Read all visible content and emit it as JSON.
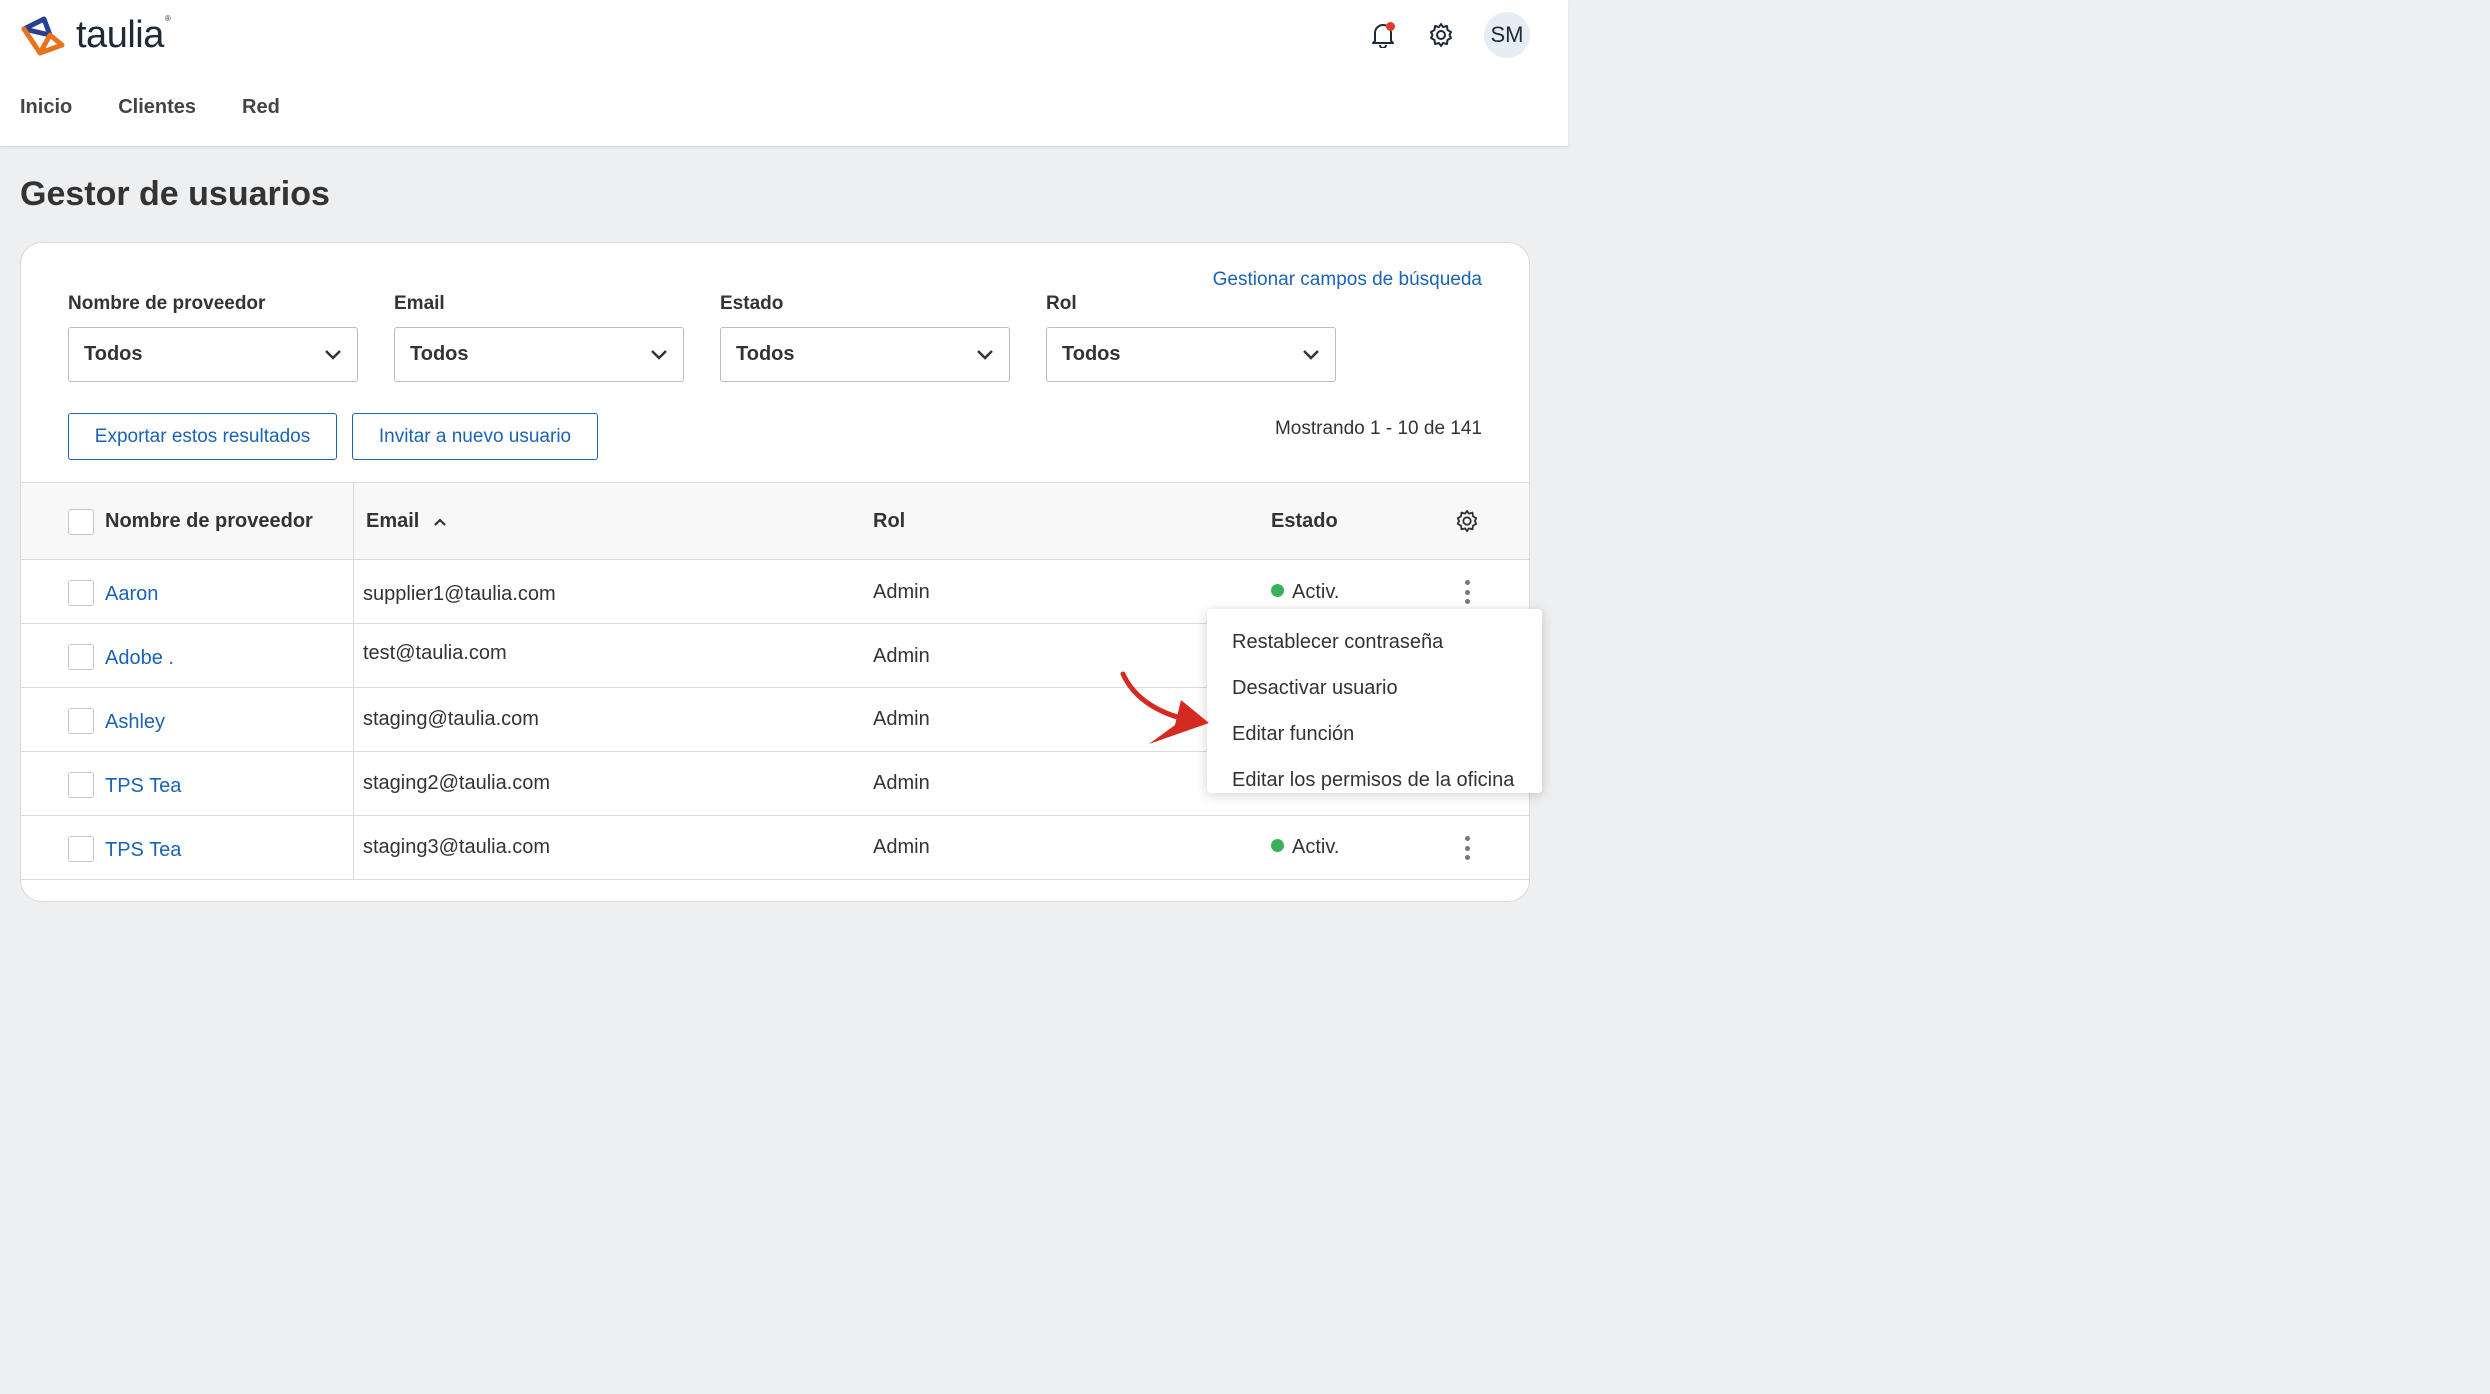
{
  "header": {
    "logo_text": "taulia",
    "user_initials": "SM"
  },
  "nav": {
    "items": [
      "Inicio",
      "Clientes",
      "Red"
    ]
  },
  "page": {
    "title": "Gestor de usuarios"
  },
  "filters": {
    "manage_link": "Gestionar campos de búsqueda",
    "items": [
      {
        "label": "Nombre de proveedor",
        "value": "Todos"
      },
      {
        "label": "Email",
        "value": "Todos"
      },
      {
        "label": "Estado",
        "value": "Todos"
      },
      {
        "label": "Rol",
        "value": "Todos"
      }
    ]
  },
  "actions": {
    "export_label": "Exportar estos resultados",
    "invite_label": "Invitar a nuevo usuario",
    "showing": "Mostrando 1 - 10 de 141"
  },
  "table": {
    "columns": {
      "name": "Nombre de proveedor",
      "email": "Email",
      "role": "Rol",
      "status": "Estado"
    },
    "rows": [
      {
        "name": "Aaron",
        "email": "supplier1@taulia.com",
        "role": "Admin",
        "status": "Activ."
      },
      {
        "name": "Adobe .",
        "email": "test@taulia.com",
        "role": "Admin",
        "status": ""
      },
      {
        "name": "Ashley",
        "email": "staging@taulia.com",
        "role": "Admin",
        "status": ""
      },
      {
        "name": "TPS Tea",
        "email": "staging2@taulia.com",
        "role": "Admin",
        "status": ""
      },
      {
        "name": "TPS Tea",
        "email": "staging3@taulia.com",
        "role": "Admin",
        "status": "Activ."
      }
    ]
  },
  "context_menu": {
    "items": [
      "Restablecer contraseña",
      "Desactivar usuario",
      "Editar función",
      "Editar los permisos de la oficina"
    ]
  },
  "colors": {
    "link": "#1b63b5",
    "active_status": "#3bb05a",
    "notification": "#e03a2f",
    "annotation_arrow": "#d42a22"
  },
  "icons": [
    "taulia-logo-icon",
    "bell-icon",
    "gear-icon",
    "chevron-down-icon",
    "sort-up-icon",
    "kebab-menu-icon",
    "annotation-arrow"
  ]
}
